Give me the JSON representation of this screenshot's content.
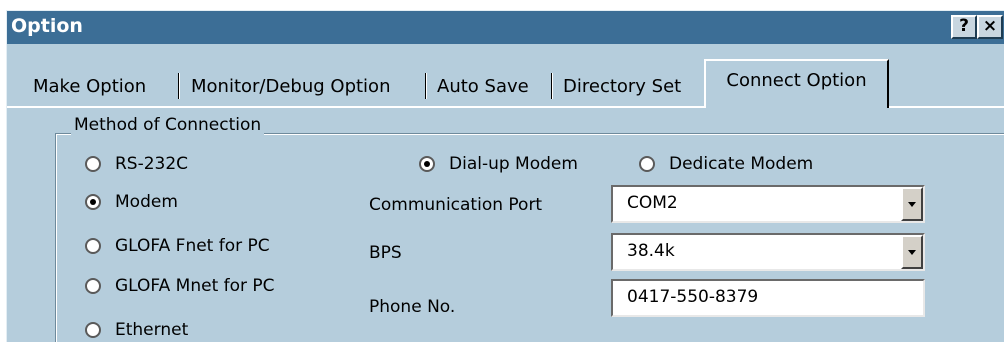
{
  "window": {
    "title": "Option",
    "help_label": "?",
    "close_label": "×"
  },
  "tabs": [
    {
      "label": "Make Option"
    },
    {
      "label": "Monitor/Debug Option"
    },
    {
      "label": "Auto Save"
    },
    {
      "label": "Directory Set"
    },
    {
      "label": "Connect Option",
      "active": true
    }
  ],
  "group": {
    "title": "Method of Connection"
  },
  "connection_methods": [
    {
      "label": "RS-232C",
      "checked": false
    },
    {
      "label": "Modem",
      "checked": true
    },
    {
      "label": "GLOFA Fnet for PC",
      "checked": false
    },
    {
      "label": "GLOFA Mnet for PC",
      "checked": false
    },
    {
      "label": "Ethernet",
      "checked": false
    }
  ],
  "modem_type": [
    {
      "label": "Dial-up Modem",
      "checked": true
    },
    {
      "label": "Dedicate Modem",
      "checked": false
    }
  ],
  "settings": {
    "port_label": "Communication Port",
    "port_value": "COM2",
    "bps_label": "BPS",
    "bps_value": "38.4k",
    "phone_label": "Phone No.",
    "phone_value": "0417-550-8379"
  },
  "icons": {
    "help": "question-mark-icon",
    "close": "close-x-icon",
    "dropdown": "chevron-down-icon",
    "radio": "radio-button-icon"
  },
  "colors": {
    "titlebar": "#3c6e96",
    "panel": "#b5cddc"
  }
}
